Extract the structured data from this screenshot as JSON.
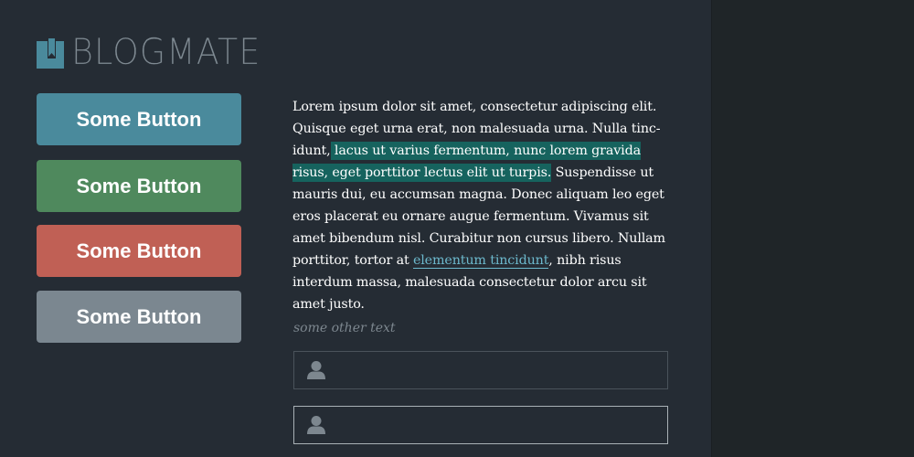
{
  "brand": {
    "name": "BLOGMATE",
    "logo_color": "#4a8a9c"
  },
  "buttons": [
    {
      "label": "Some Button",
      "color": "#4a8a9c"
    },
    {
      "label": "Some Button",
      "color": "#4f895d"
    },
    {
      "label": "Some Button",
      "color": "#c06055"
    },
    {
      "label": "Some Button",
      "color": "#7b8790"
    }
  ],
  "article": {
    "text_before": "Lorem ipsum dolor sit amet, consectetur adipiscing elit. Quisque eget urna erat, non malesuada urna. Nulla tinc­idunt,",
    "highlight": " lacus ut varius fermentum, nunc lorem gravida risus, eget porttitor lectus elit ut turpis.",
    "text_middle": " Suspendisse ut mauris dui, eu accumsan magna. Donec aliquam leo eget eros placerat eu ornare augue fermentum. Vivamus sit amet bibendum nisl. Curabitur non cursus libero. Nullam porttitor, tortor at ",
    "link_text": "elementum tincidunt",
    "text_after": ", nibh risus interdum massa, malesuada consectetur dolor arcu sit amet justo.",
    "highlight_color": "#16635e",
    "link_color": "#6cb8cc"
  },
  "other_text": "some other text",
  "fields": [
    {
      "icon": "user-icon",
      "value": "",
      "placeholder": ""
    },
    {
      "icon": "user-icon",
      "value": "",
      "placeholder": ""
    }
  ]
}
